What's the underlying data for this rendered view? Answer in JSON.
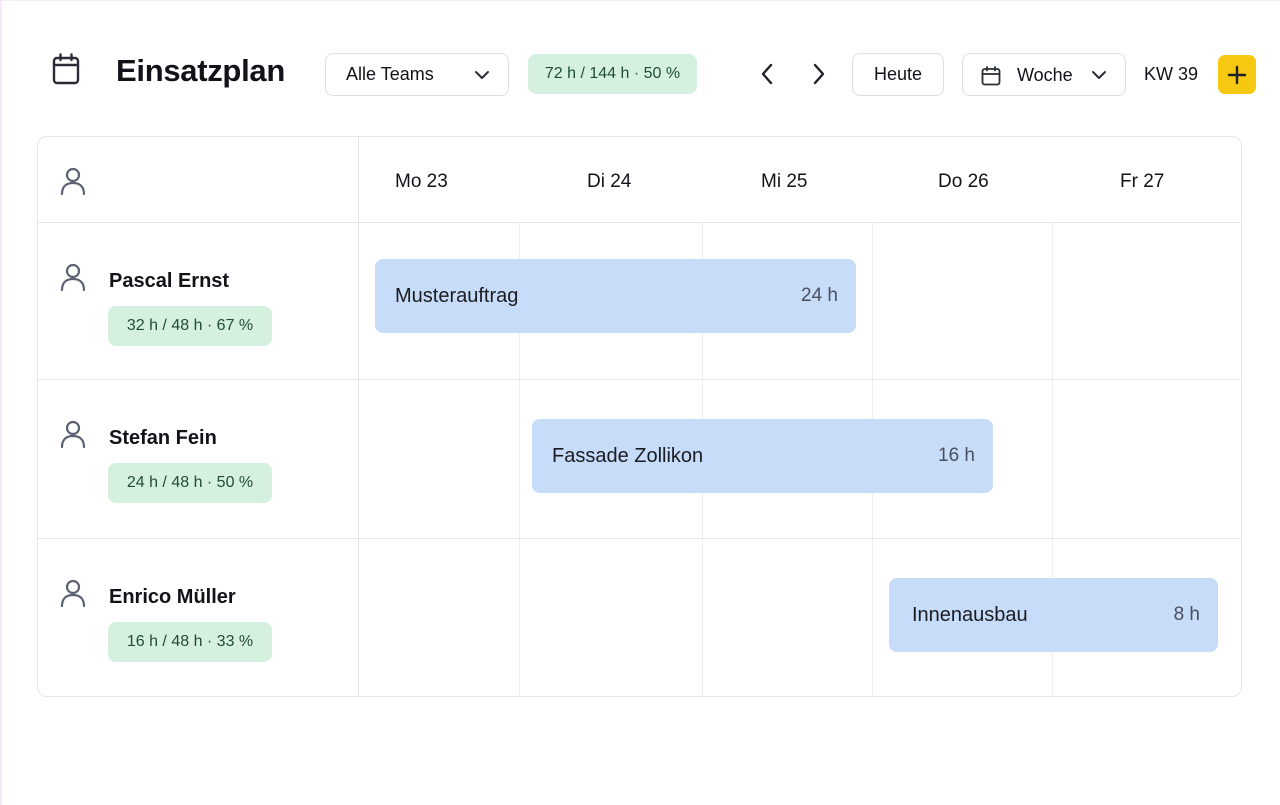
{
  "app": {
    "title": "Einsatzplan",
    "icon": "calendar-icon"
  },
  "toolbar": {
    "team_filter": "Alle Teams",
    "total_capacity": "72 h / 144 h · 50 %",
    "today_label": "Heute",
    "view_mode": "Woche",
    "week_label": "KW 39"
  },
  "days": [
    {
      "label": "Mo 23"
    },
    {
      "label": "Di 24"
    },
    {
      "label": "Mi 25"
    },
    {
      "label": "Do 26"
    },
    {
      "label": "Fr 27"
    }
  ],
  "people": [
    {
      "name": "Pascal Ernst",
      "capacity": "32 h / 48 h · 67 %"
    },
    {
      "name": "Stefan Fein",
      "capacity": "24 h / 48 h · 50 %"
    },
    {
      "name": "Enrico Müller",
      "capacity": "16 h / 48 h · 33 %"
    }
  ],
  "assignments": [
    {
      "title": "Musterauftrag",
      "hours": "24 h",
      "person": 0,
      "start_day": "Mo 23",
      "end_day": "Mi 25"
    },
    {
      "title": "Fassade Zollikon",
      "hours": "16 h",
      "person": 1,
      "start_day": "Di 24",
      "end_day": "Do 26"
    },
    {
      "title": "Innenausbau",
      "hours": "8 h",
      "person": 2,
      "start_day": "Do 26",
      "end_day": "Fr 27"
    }
  ],
  "colors": {
    "accent": "#f7c811",
    "capacity_badge_bg": "#d6f0e0",
    "capacity_badge_text": "#1f4d33",
    "assignment_bg": "#c7dcf8"
  }
}
